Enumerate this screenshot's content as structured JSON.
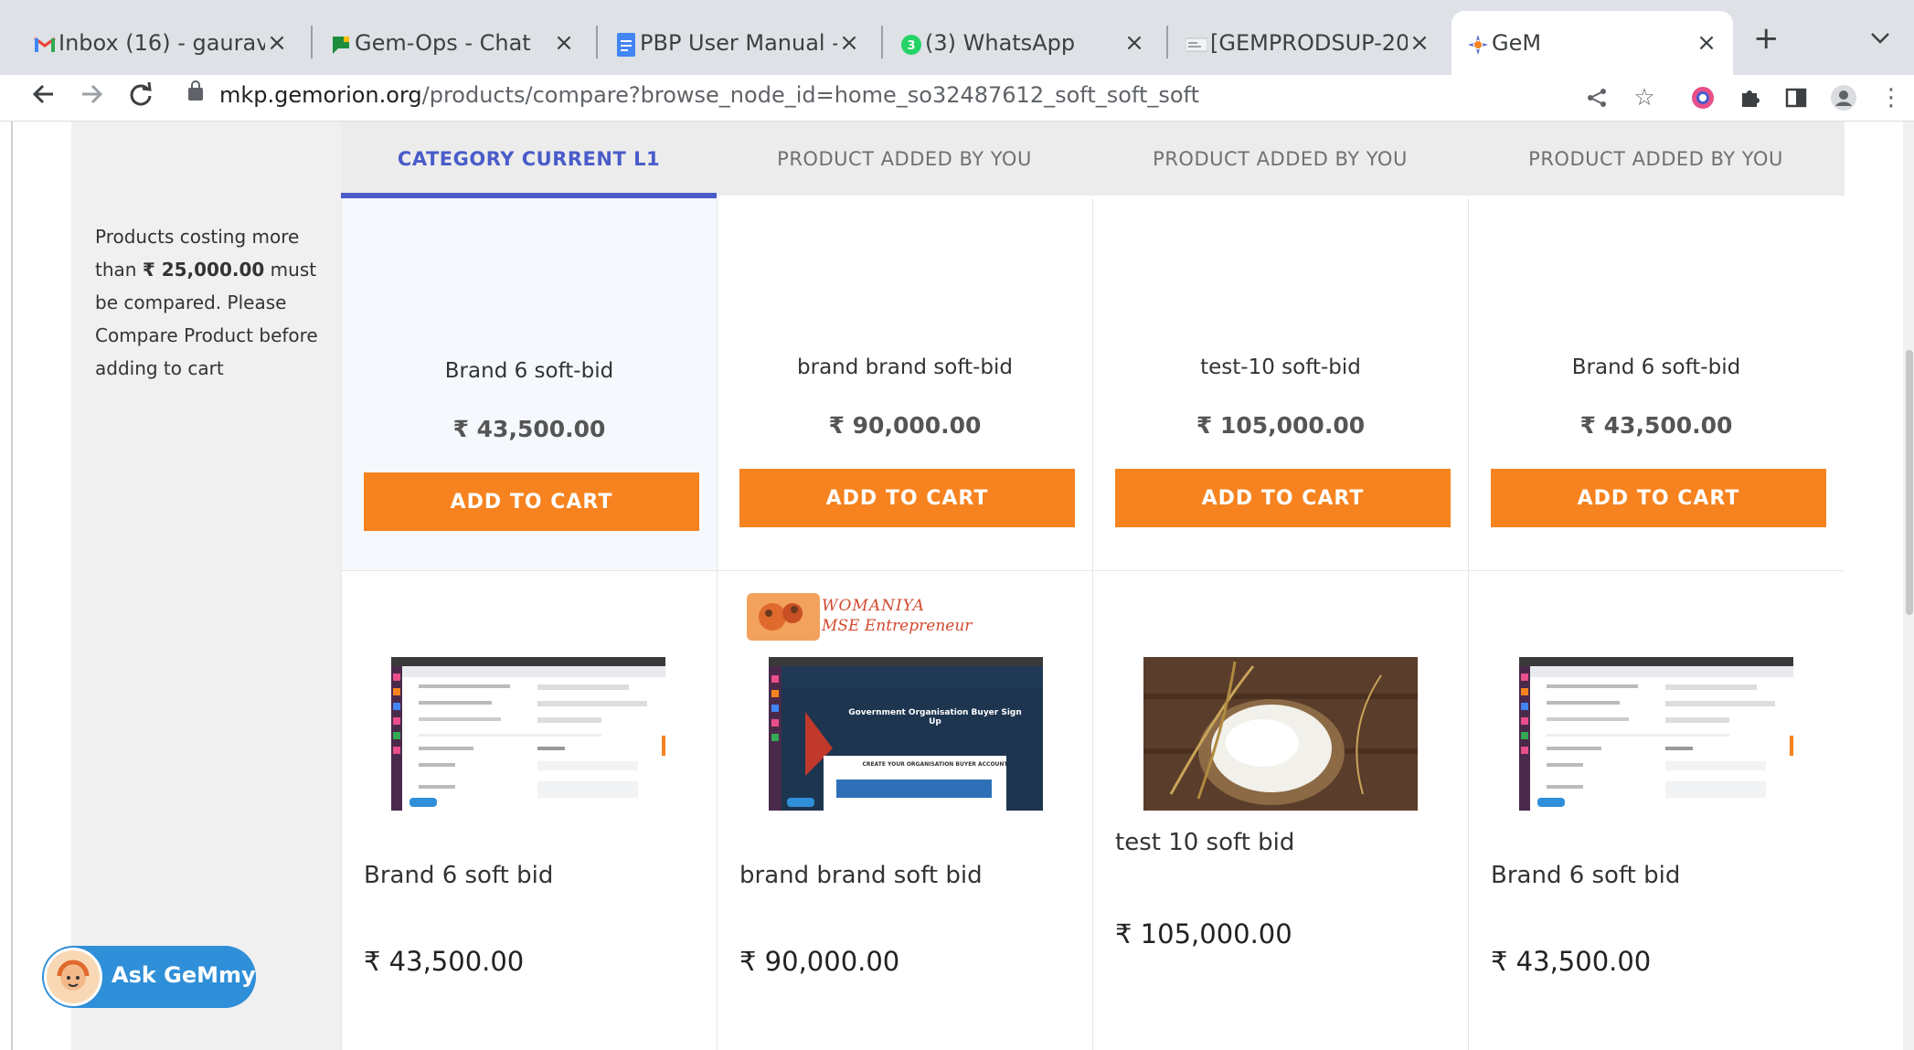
{
  "browser": {
    "tabs": [
      {
        "label": "Inbox (16) - gaurav",
        "icon": "gmail-icon"
      },
      {
        "label": "Gem-Ops - Chat",
        "icon": "chat-icon"
      },
      {
        "label": "PBP User Manual -",
        "icon": "docs-icon"
      },
      {
        "label": "(3) WhatsApp",
        "icon": "whatsapp-icon"
      },
      {
        "label": "[GEMPRODSUP-20",
        "icon": "jira-icon"
      },
      {
        "label": "GeM",
        "icon": "gem-icon"
      }
    ],
    "active_tab": 5,
    "url_host": "mkp.gemorion.org",
    "url_path": "/products/compare?browse_node_id=home_so32487612_soft_soft_soft"
  },
  "notice": {
    "prefix": "Products costing more than",
    "amount": "₹ 25,000.00",
    "suffix": "must be compared. Please Compare Product before adding to cart"
  },
  "columns": [
    {
      "header": "CATEGORY CURRENT L1",
      "name": "Brand 6 soft-bid",
      "price": "₹ 43,500.00",
      "button": "ADD TO CART",
      "product_title": "Brand 6 soft bid",
      "product_price": "₹ 43,500.00",
      "thumb_badge": ""
    },
    {
      "header": "PRODUCT ADDED BY YOU",
      "name": "brand brand soft-bid",
      "price": "₹ 90,000.00",
      "button": "ADD TO CART",
      "product_title": "brand brand soft bid",
      "product_price": "₹ 90,000.00",
      "thumb_badge": "WOMANIYA",
      "thumb_badge_sub": "MSE Entrepreneur",
      "thumb_banner": "Government Organisation Buyer Sign Up",
      "thumb_subbanner": "CREATE YOUR ORGANISATION BUYER ACCOUNT"
    },
    {
      "header": "PRODUCT ADDED BY YOU",
      "name": "test-10 soft-bid",
      "price": "₹ 105,000.00",
      "button": "ADD TO CART",
      "product_title": "test 10 soft bid",
      "product_price": "₹ 105,000.00",
      "thumb_badge": ""
    },
    {
      "header": "PRODUCT ADDED BY YOU",
      "name": "Brand 6 soft-bid",
      "price": "₹ 43,500.00",
      "button": "ADD TO CART",
      "product_title": "Brand 6 soft bid",
      "product_price": "₹ 43,500.00",
      "thumb_badge": ""
    }
  ],
  "assistant": {
    "label": "Ask GeMmy"
  },
  "colors": {
    "accent": "#4a5cc9",
    "cart_button": "#f6831f",
    "assistant": "#2f8fd8"
  }
}
